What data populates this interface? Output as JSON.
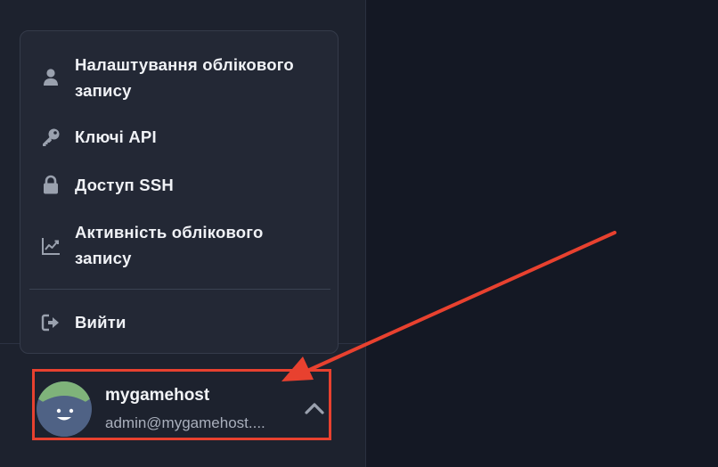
{
  "menu": {
    "items": [
      {
        "label": "Налаштування облікового запису",
        "icon": "user-icon"
      },
      {
        "label": "Ключі API",
        "icon": "key-icon"
      },
      {
        "label": "Доступ SSH",
        "icon": "lock-icon"
      },
      {
        "label": "Активність облікового запису",
        "icon": "chart-line-icon"
      }
    ],
    "logout": {
      "label": "Вийти",
      "icon": "logout-icon"
    }
  },
  "profile": {
    "name": "mygamehost",
    "email": "admin@mygamehost....",
    "expanded_icon": "chevron-up-icon"
  },
  "colors": {
    "highlight": "#e8412f",
    "sidebar_bg": "#1d222e",
    "main_bg": "#141824",
    "menu_bg": "#232835",
    "avatar_top": "#7fb37a",
    "avatar_face": "#4f6285"
  }
}
